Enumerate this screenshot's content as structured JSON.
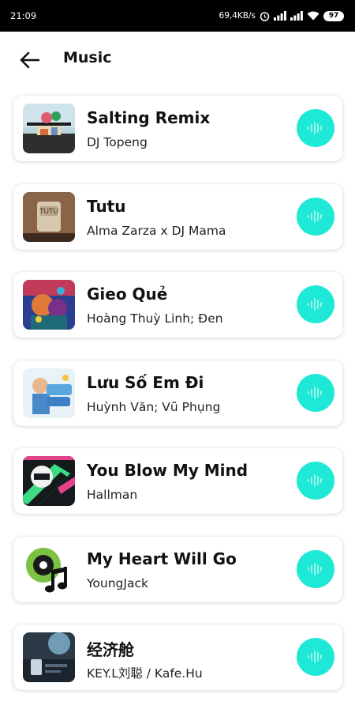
{
  "status_bar": {
    "time": "21:09",
    "net_speed": "69,4KB/s",
    "battery": "97",
    "accent": "#000000"
  },
  "header": {
    "title": "Music",
    "back_icon": "arrow-left-icon"
  },
  "theme": {
    "play_button_color": "#1de9d6"
  },
  "songs": [
    {
      "title": "Salting Remix",
      "artist": "DJ Topeng"
    },
    {
      "title": "Tutu",
      "artist": "Alma Zarza x DJ Mama"
    },
    {
      "title": "Gieo Quẻ",
      "artist": "Hoàng Thuỳ Linh; Đen"
    },
    {
      "title": "Lưu Số Em Đi",
      "artist": "Huỳnh Văn; Vũ Phụng"
    },
    {
      "title": "You Blow My Mind",
      "artist": "Hallman"
    },
    {
      "title": "My Heart Will Go",
      "artist": "YoungJack"
    },
    {
      "title": "经济舱",
      "artist": "KEY.L刘聪 / Kafe.Hu"
    }
  ]
}
